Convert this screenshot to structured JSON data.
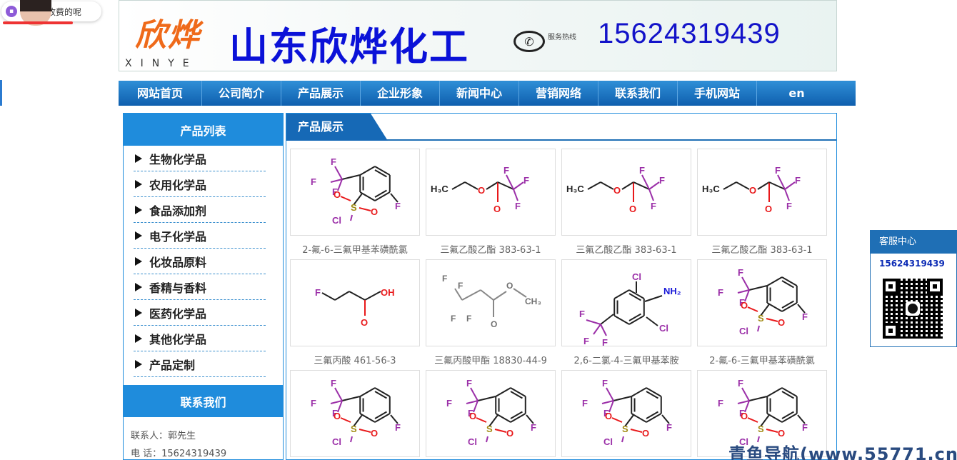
{
  "overlay": {
    "chat_text": "你…么收费的呢"
  },
  "banner": {
    "logo_text": "欣烨",
    "logo_sub": "XINYE",
    "company_name": "山东欣烨化工",
    "hotline_label": "服务热线",
    "hotline_number": "15624319439"
  },
  "nav": {
    "items": [
      "网站首页",
      "公司简介",
      "产品展示",
      "企业形象",
      "新闻中心",
      "营销网络",
      "联系我们",
      "手机网站",
      "en"
    ]
  },
  "sidebar": {
    "title": "产品列表",
    "categories": [
      "生物化学品",
      "农用化学品",
      "食品添加剂",
      "电子化学品",
      "化妆品原料",
      "香精与香料",
      "医药化学品",
      "其他化学品",
      "产品定制"
    ],
    "contact_title": "联系我们",
    "contact_person": "联系人：郭先生",
    "contact_phone": "电 话：15624319439"
  },
  "main": {
    "title": "产品展示",
    "products": [
      {
        "name": "2-氟-6-三氟甲基苯磺酰氯",
        "structure": "aryl-sulfonyl"
      },
      {
        "name": "三氟乙酸乙酯 383-63-1",
        "structure": "ester"
      },
      {
        "name": "三氟乙酸乙酯 383-63-1",
        "structure": "ester"
      },
      {
        "name": "三氟乙酸乙酯 383-63-1",
        "structure": "ester"
      },
      {
        "name": "三氟丙酸 461-56-3",
        "structure": "acid"
      },
      {
        "name": "三氟丙酸甲酯 18830-44-9",
        "structure": "methyl-ester"
      },
      {
        "name": "2,6-二氯-4-三氟甲基苯胺",
        "structure": "aniline"
      },
      {
        "name": "2-氟-6-三氟甲基苯磺酰氯",
        "structure": "aryl-sulfonyl"
      },
      {
        "name": "",
        "structure": "aryl-sulfonyl"
      },
      {
        "name": "",
        "structure": "aryl-sulfonyl"
      },
      {
        "name": "",
        "structure": "aryl-sulfonyl"
      },
      {
        "name": "",
        "structure": "aryl-sulfonyl"
      }
    ]
  },
  "service": {
    "title": "客服中心",
    "phone": "15624319439"
  },
  "watermark": "青鱼导航(www.55771.cn)",
  "colors": {
    "nav": "#1669b6",
    "accent": "#1f8cdc",
    "brand_orange": "#ef6a1a",
    "brand_blue": "#0b12d8"
  }
}
